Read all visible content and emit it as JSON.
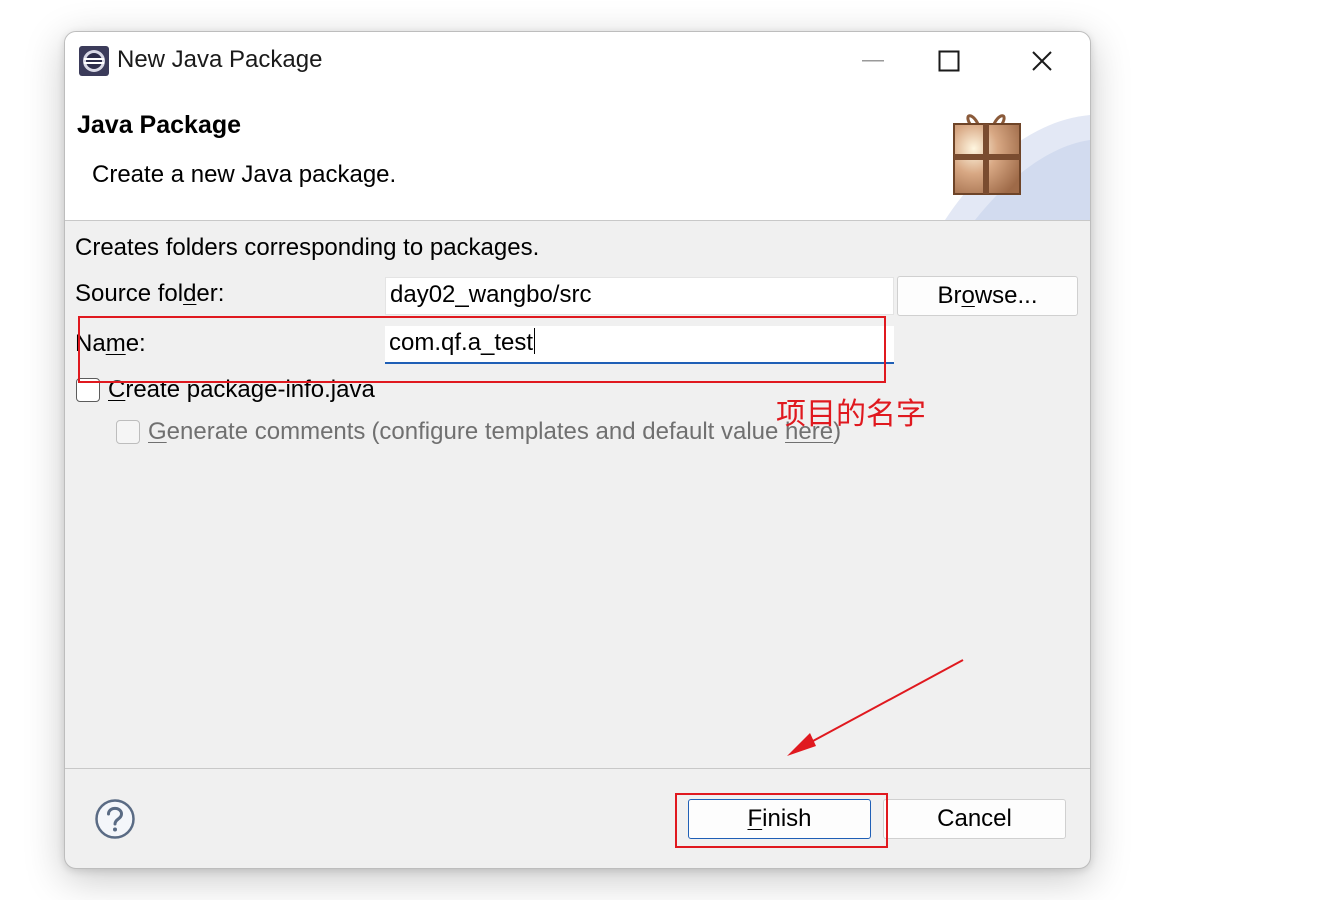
{
  "window": {
    "title": "New Java Package",
    "minimize_icon": "minimize-icon",
    "maximize_icon": "maximize-icon",
    "close_icon": "close-icon"
  },
  "banner": {
    "title": "Java Package",
    "description": "Create a new Java package.",
    "icon": "package-gift-icon"
  },
  "form": {
    "intro": "Creates folders corresponding to packages.",
    "source_folder": {
      "label_pre": "Source fol",
      "label_mnemonic": "d",
      "label_post": "er:",
      "value": "day02_wangbo/src"
    },
    "browse": {
      "pre": "Br",
      "mnemonic": "o",
      "post": "wse..."
    },
    "name": {
      "label_pre": "Na",
      "label_mnemonic": "m",
      "label_post": "e:",
      "value": "com.qf.a_test"
    },
    "create_package_info": {
      "mnemonic": "C",
      "label_post": "reate package-info.java",
      "checked": false
    },
    "generate_comments": {
      "mnemonic": "G",
      "label_post": "enerate comments",
      "config_pre": "(configure templates and default value ",
      "config_link": "here",
      "config_post": ")",
      "checked": false,
      "enabled": false
    }
  },
  "footer": {
    "help_icon": "help-icon",
    "finish": {
      "mnemonic": "F",
      "post": "inish"
    },
    "cancel": "Cancel"
  },
  "annotations": {
    "name_note": "项目的名字",
    "color": "#e0191f"
  },
  "colors": {
    "accent": "#1f5fb6",
    "dialog_bg": "#f0f0f0"
  }
}
